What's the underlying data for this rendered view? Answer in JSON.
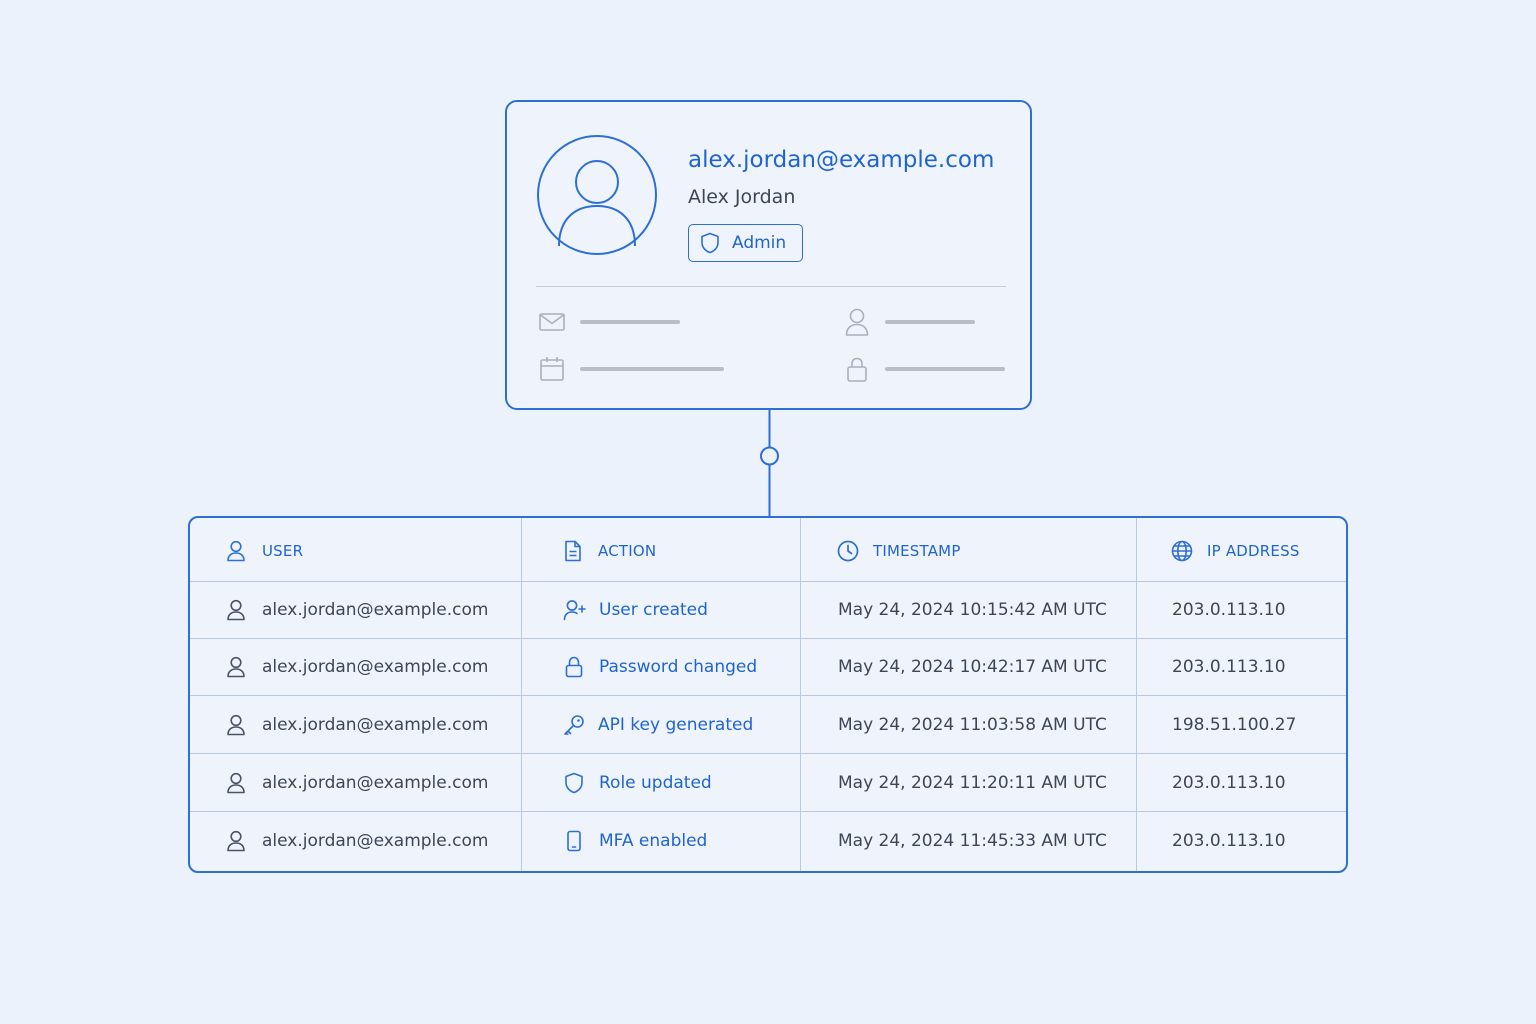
{
  "profile": {
    "email": "alex.jordan@example.com",
    "name": "Alex Jordan",
    "role_badge": "Admin",
    "avatar_icon": "user-avatar-icon",
    "details": [
      {
        "icon": "mail-icon"
      },
      {
        "icon": "user-icon"
      },
      {
        "icon": "calendar-icon"
      },
      {
        "icon": "lock-icon"
      }
    ]
  },
  "table": {
    "headers": [
      {
        "label": "USER",
        "icon": "user-icon"
      },
      {
        "label": "ACTION",
        "icon": "document-icon"
      },
      {
        "label": "TIMESTAMP",
        "icon": "clock-icon"
      },
      {
        "label": "IP ADDRESS",
        "icon": "globe-icon"
      }
    ],
    "rows": [
      {
        "user": "alex.jordan@example.com",
        "action": "User created",
        "action_icon": "user-plus-icon",
        "timestamp": "May 24, 2024 10:15:42 AM UTC",
        "ip": "203.0.113.10"
      },
      {
        "user": "alex.jordan@example.com",
        "action": "Password changed",
        "action_icon": "lock-icon",
        "timestamp": "May 24, 2024 10:42:17 AM UTC",
        "ip": "203.0.113.10"
      },
      {
        "user": "alex.jordan@example.com",
        "action": "API key generated",
        "action_icon": "key-icon",
        "timestamp": "May 24, 2024 11:03:58 AM UTC",
        "ip": "198.51.100.27"
      },
      {
        "user": "alex.jordan@example.com",
        "action": "Role updated",
        "action_icon": "shield-icon",
        "timestamp": "May 24, 2024 11:20:11 AM UTC",
        "ip": "203.0.113.10"
      },
      {
        "user": "alex.jordan@example.com",
        "action": "MFA enabled",
        "action_icon": "smartphone-icon",
        "timestamp": "May 24, 2024 11:45:33 AM UTC",
        "ip": "203.0.113.10"
      }
    ]
  },
  "colors": {
    "accent": "#1f64d1",
    "border": "#2d6fd6",
    "background": "#ecf2fb",
    "text": "#3e4656",
    "muted": "#b8bec8"
  }
}
